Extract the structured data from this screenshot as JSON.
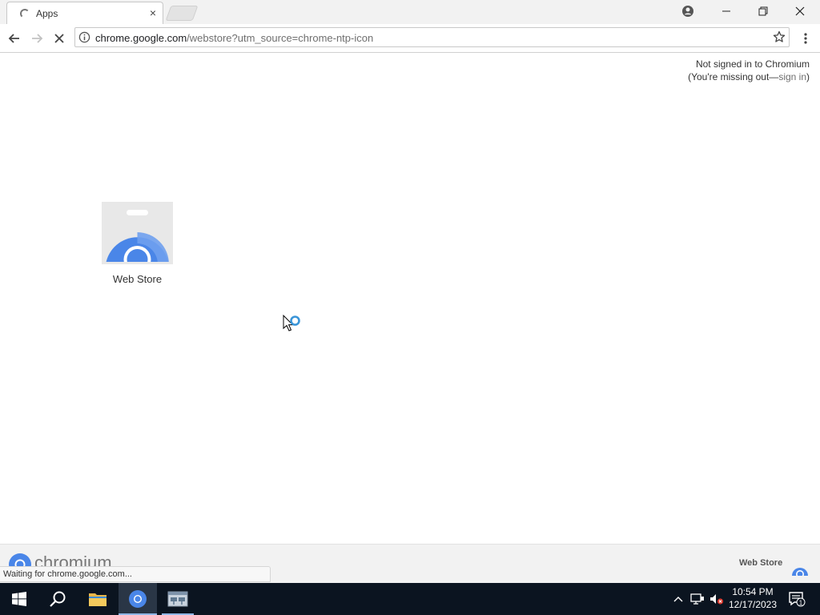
{
  "browser": {
    "tab": {
      "title": "Apps",
      "close_glyph": "×"
    },
    "url": {
      "host": "chrome.google.com",
      "rest": "/webstore?utm_source=chrome-ntp-icon"
    }
  },
  "page": {
    "signin": {
      "line1": "Not signed in to Chromium",
      "line2_prefix": "(You're missing out—",
      "link": "sign in",
      "line2_suffix": ")"
    },
    "apps": [
      {
        "label": "Web Store",
        "icon": "webstore-icon"
      }
    ]
  },
  "bottom_bar": {
    "wordmark": "chromium",
    "webstore_label": "Web Store"
  },
  "status_text": "Waiting for chrome.google.com...",
  "taskbar": {
    "time": "10:54 PM",
    "date": "12/17/2023",
    "notification_count": "1"
  },
  "colors": {
    "accent_blue": "#4285f4",
    "taskbar_bg": "#0b1420"
  }
}
